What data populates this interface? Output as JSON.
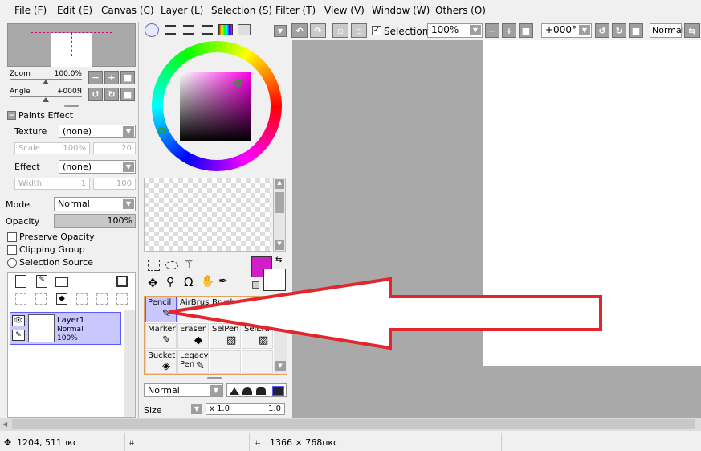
{
  "menu": [
    "File (F)",
    "Edit (E)",
    "Canvas (C)",
    "Layer (L)",
    "Selection (S)",
    "Filter (T)",
    "View (V)",
    "Window (W)",
    "Others (O)"
  ],
  "navigator": {
    "zoom_label": "Zoom",
    "zoom_value": "100.0%",
    "angle_label": "Angle",
    "angle_value": "+000Я"
  },
  "paints_effect": {
    "header": "Paints Effect",
    "texture_label": "Texture",
    "texture_value": "(none)",
    "scale_label": "Scale",
    "scale_value": "100%",
    "scale_num": "20",
    "effect_label": "Effect",
    "effect_value": "(none)",
    "width_label": "Width",
    "width_value": "1",
    "width_num": "100"
  },
  "layer_props": {
    "mode_label": "Mode",
    "mode_value": "Normal",
    "opacity_label": "Opacity",
    "opacity_value": "100%",
    "preserve_opacity": "Preserve Opacity",
    "clipping_group": "Clipping Group",
    "selection_source": "Selection Source"
  },
  "layer": {
    "name": "Layer1",
    "mode": "Normal",
    "opacity": "100%"
  },
  "tools": {
    "row1": [
      "Pencil",
      "AirBrush",
      "Brush",
      ""
    ],
    "row2": [
      "Marker",
      "Eraser",
      "SelPen",
      "SelEra"
    ],
    "row3": [
      "Bucket",
      "Legacy Pen",
      "",
      ""
    ],
    "blend_mode": "Normal",
    "size_label": "Size",
    "size_mult": "x 1.0",
    "size_value": "1.0"
  },
  "toolbar": {
    "selection_label": "Selection",
    "zoom_value": "100%",
    "angle_value": "+000°",
    "mode_value": "Normal"
  },
  "colors": {
    "primary": "#d11fc8",
    "secondary": "#ffffff",
    "arrow_red": "#e3262e",
    "selected_tool": "#c8c8ff"
  },
  "status": {
    "cursor": "1204, 511пкс",
    "canvas_size": "1366 × 768пкс"
  }
}
